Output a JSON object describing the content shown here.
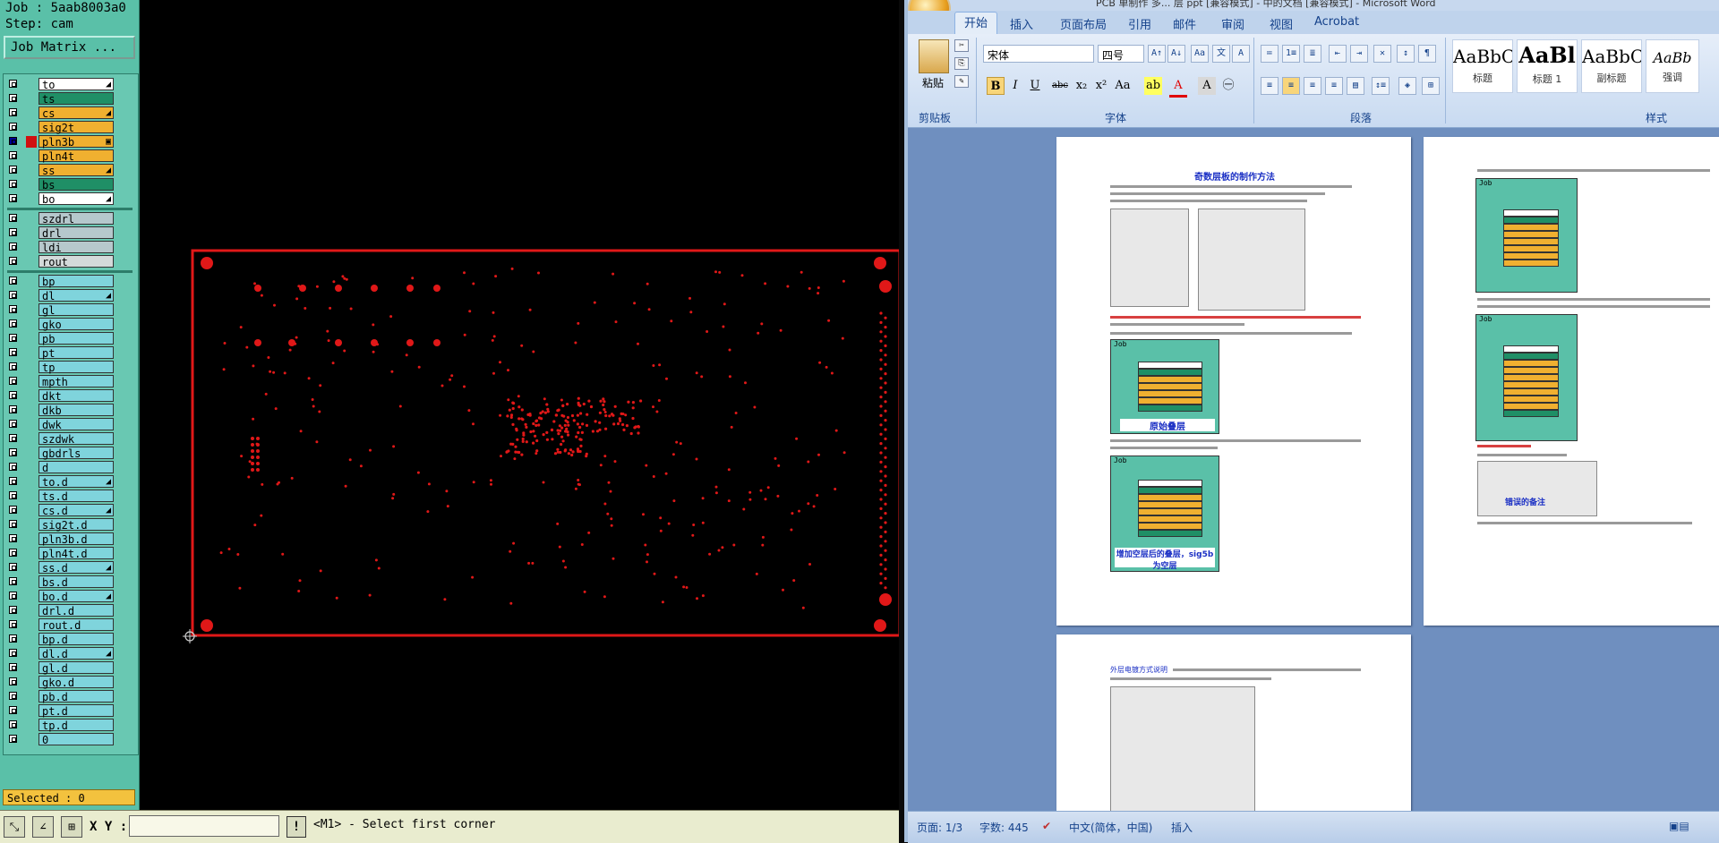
{
  "cam": {
    "job_line": "Job : 5aab8003a0",
    "step_line": "Step: cam",
    "job_matrix_label": "Job Matrix ...",
    "layers": [
      {
        "name": "to",
        "color": "white",
        "arrow": "◢",
        "group": 1
      },
      {
        "name": "ts",
        "color": "green",
        "group": 1
      },
      {
        "name": "cs",
        "color": "orange",
        "arrow": "◢",
        "group": 1
      },
      {
        "name": "sig2t",
        "color": "orange",
        "group": 1
      },
      {
        "name": "pln3b",
        "color": "orange",
        "active": true,
        "arrow": "▣",
        "group": 1
      },
      {
        "name": "pln4t",
        "color": "orange",
        "group": 1
      },
      {
        "name": "ss",
        "color": "orange",
        "arrow": "◢",
        "group": 1
      },
      {
        "name": "bs",
        "color": "green",
        "group": 1
      },
      {
        "name": "bo",
        "color": "white",
        "arrow": "◢",
        "group": 1
      },
      {
        "name": "szdrl",
        "color": "gray",
        "group": 2
      },
      {
        "name": "drl",
        "color": "gray",
        "group": 2
      },
      {
        "name": "ldi",
        "color": "gray",
        "group": 2
      },
      {
        "name": "rout",
        "color": "lightgray",
        "group": 2
      },
      {
        "name": "bp",
        "color": "cyan",
        "group": 3
      },
      {
        "name": "dl",
        "color": "cyan",
        "arrow": "◢",
        "group": 3
      },
      {
        "name": "gl",
        "color": "cyan",
        "group": 3
      },
      {
        "name": "gko",
        "color": "cyan",
        "group": 3
      },
      {
        "name": "pb",
        "color": "cyan",
        "group": 3
      },
      {
        "name": "pt",
        "color": "cyan",
        "group": 3
      },
      {
        "name": "tp",
        "color": "cyan",
        "group": 3
      },
      {
        "name": "mpth",
        "color": "cyan",
        "group": 3
      },
      {
        "name": "dkt",
        "color": "cyan",
        "group": 3
      },
      {
        "name": "dkb",
        "color": "cyan",
        "group": 3
      },
      {
        "name": "dwk",
        "color": "cyan",
        "group": 3
      },
      {
        "name": "szdwk",
        "color": "cyan",
        "group": 3
      },
      {
        "name": "gbdrls",
        "color": "cyan",
        "group": 3
      },
      {
        "name": "d",
        "color": "cyan",
        "group": 3
      },
      {
        "name": "to.d",
        "color": "cyan",
        "arrow": "◢",
        "group": 3
      },
      {
        "name": "ts.d",
        "color": "cyan",
        "group": 3
      },
      {
        "name": "cs.d",
        "color": "cyan",
        "arrow": "◢",
        "group": 3
      },
      {
        "name": "sig2t.d",
        "color": "cyan",
        "group": 3
      },
      {
        "name": "pln3b.d",
        "color": "cyan",
        "group": 3
      },
      {
        "name": "pln4t.d",
        "color": "cyan",
        "group": 3
      },
      {
        "name": "ss.d",
        "color": "cyan",
        "arrow": "◢",
        "group": 3
      },
      {
        "name": "bs.d",
        "color": "cyan",
        "group": 3
      },
      {
        "name": "bo.d",
        "color": "cyan",
        "arrow": "◢",
        "group": 3
      },
      {
        "name": "drl.d",
        "color": "cyan",
        "group": 3
      },
      {
        "name": "rout.d",
        "color": "cyan",
        "group": 3
      },
      {
        "name": "bp.d",
        "color": "cyan",
        "group": 3
      },
      {
        "name": "dl.d",
        "color": "cyan",
        "arrow": "◢",
        "group": 3
      },
      {
        "name": "gl.d",
        "color": "cyan",
        "group": 3
      },
      {
        "name": "gko.d",
        "color": "cyan",
        "group": 3
      },
      {
        "name": "pb.d",
        "color": "cyan",
        "group": 3
      },
      {
        "name": "pt.d",
        "color": "cyan",
        "group": 3
      },
      {
        "name": "tp.d",
        "color": "cyan",
        "group": 3
      },
      {
        "name": "0",
        "color": "cyan",
        "group": 3
      }
    ],
    "selected_label": "Selected : 0",
    "xy_label": "X Y :",
    "xy_value": "",
    "excl_label": "!",
    "status_message": "<M1> - Select first corner",
    "board_color": "#e01818"
  },
  "word": {
    "title_fragment": "PCB 单制作 多... 层 ppt [兼容模式] - 中的文档 [兼容模式] - Microsoft Word",
    "tabs": [
      "开始",
      "插入",
      "页面布局",
      "引用",
      "邮件",
      "审阅",
      "视图",
      "Acrobat"
    ],
    "active_tab": "开始",
    "font_name": "宋体",
    "font_size": "四号",
    "paste_label": "粘贴",
    "group_labels": {
      "clipboard": "剪贴板",
      "font": "字体",
      "paragraph": "段落",
      "styles": "样式"
    },
    "styles": [
      {
        "sample": "AaBbC",
        "name": "标题"
      },
      {
        "sample": "AaBl",
        "name": "标题 1"
      },
      {
        "sample": "AaBbC",
        "name": "副标题"
      },
      {
        "sample": "AaBb",
        "name": "强调"
      }
    ],
    "doc": {
      "page1_title": "奇数层板的制作方法",
      "page1_caption1": "原始叠层",
      "page1_caption2": "增加空层后的叠层，sig5b为空层",
      "page2_caption": "错误的备注",
      "page3_intro": "外层电镀方式说明"
    },
    "status": {
      "page": "页面: 1/3",
      "words": "字数: 445",
      "lang": "中文(简体，中国)",
      "mode": "插入"
    }
  }
}
